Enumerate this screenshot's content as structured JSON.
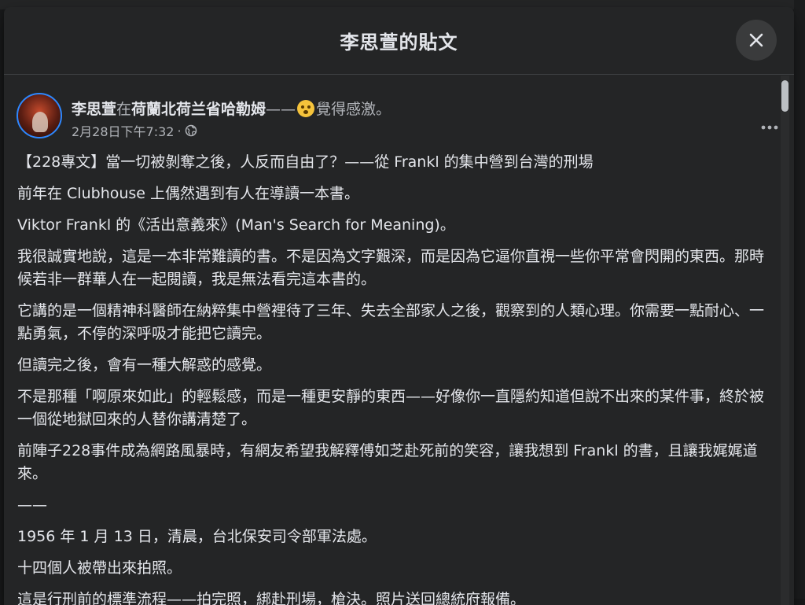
{
  "modal": {
    "title": "李思萱的貼文"
  },
  "post": {
    "author": "李思萱",
    "at_word": "在",
    "place": "荷蘭北荷兰省哈勒姆",
    "dash": "——",
    "feeling": "覺得感激。",
    "timestamp": "2月28日下午7:32",
    "separator": "·",
    "audience_icon": "globe-icon",
    "paragraphs": [
      "【228專文】當一切被剝奪之後，人反而自由了？——從 Frankl 的集中營到台灣的刑場",
      "前年在 Clubhouse 上偶然遇到有人在導讀一本書。",
      "Viktor Frankl 的《活出意義來》(Man's Search for Meaning)。",
      "我很誠實地說，這是一本非常難讀的書。不是因為文字艱深，而是因為它逼你直視一些你平常會閃開的東西。那時候若非一群華人在一起閱讀，我是無法看完這本書的。",
      "它講的是一個精神科醫師在納粹集中營裡待了三年、失去全部家人之後，觀察到的人類心理。你需要一點耐心、一點勇氣，不停的深呼吸才能把它讀完。",
      "但讀完之後，會有一種大解惑的感覺。",
      "不是那種「啊原來如此」的輕鬆感，而是一種更安靜的東西——好像你一直隱約知道但說不出來的某件事，終於被一個從地獄回來的人替你講清楚了。",
      "前陣子228事件成為網路風暴時，有網友希望我解釋傅如芝赴死前的笑容，讓我想到 Frankl 的書，且讓我娓娓道來。",
      "——",
      "1956 年 1 月 13 日，清晨，台北保安司令部軍法處。",
      "十四個人被帶出來拍照。",
      "這是行刑前的標準流程——拍完照，綁赴刑場，槍決。照片送回總統府報備。"
    ]
  },
  "colors": {
    "page_bg": "#18191a",
    "modal_bg": "#242526",
    "text_primary": "#e4e6eb",
    "text_secondary": "#b0b3b8",
    "close_button_bg": "#3a3b3c"
  }
}
